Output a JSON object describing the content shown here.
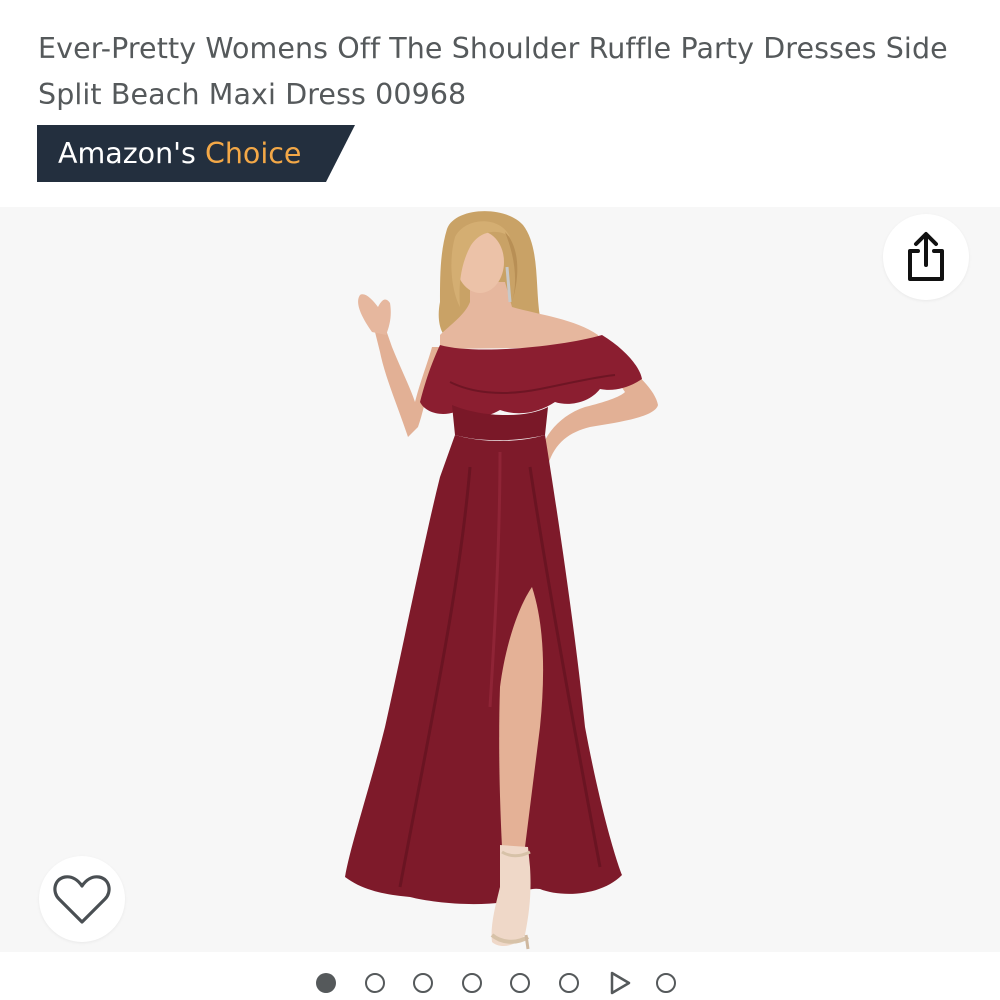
{
  "product": {
    "title": "Ever-Pretty Womens Off The Shoulder Ruffle Party Dresses Side Split Beach Maxi Dress 00968"
  },
  "badge": {
    "prefix": "Amazon's",
    "highlight": "Choice",
    "background_color": "#232f3e",
    "highlight_color": "#f3a847"
  },
  "gallery": {
    "image_subject": "Model wearing burgundy off-the-shoulder ruffle maxi dress with side split",
    "dress_color": "#7e1a2a",
    "share_icon": "share-icon",
    "wishlist_icon": "heart-outline-icon",
    "current_index": 1,
    "indicators": [
      {
        "type": "image",
        "active": true
      },
      {
        "type": "image",
        "active": false
      },
      {
        "type": "image",
        "active": false
      },
      {
        "type": "image",
        "active": false
      },
      {
        "type": "image",
        "active": false
      },
      {
        "type": "image",
        "active": false
      },
      {
        "type": "video",
        "active": false
      },
      {
        "type": "image",
        "active": false
      }
    ]
  }
}
